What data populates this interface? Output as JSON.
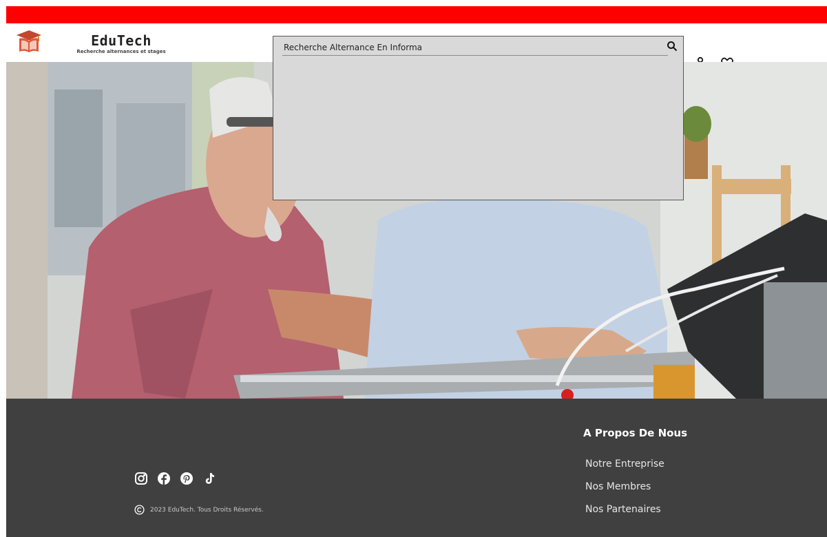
{
  "brand": {
    "name": "EduTech",
    "tagline": "Recherche alternances et stages"
  },
  "search": {
    "value": "Recherche Alternance En Informa",
    "icon": "search-icon"
  },
  "header_icons": [
    "user-icon",
    "heart-icon"
  ],
  "footer": {
    "about_title": "A Propos De Nous",
    "links": [
      "Notre Entreprise",
      "Nos Membres",
      "Nos Partenaires"
    ],
    "social_icons": [
      "instagram-icon",
      "facebook-icon",
      "pinterest-icon",
      "tiktok-icon"
    ],
    "copyright": "2023 EduTech. Tous Droits Réservés."
  },
  "colors": {
    "top_bar": "#ff0000",
    "footer_bg": "#404040",
    "search_panel": "#d9d9d9"
  }
}
